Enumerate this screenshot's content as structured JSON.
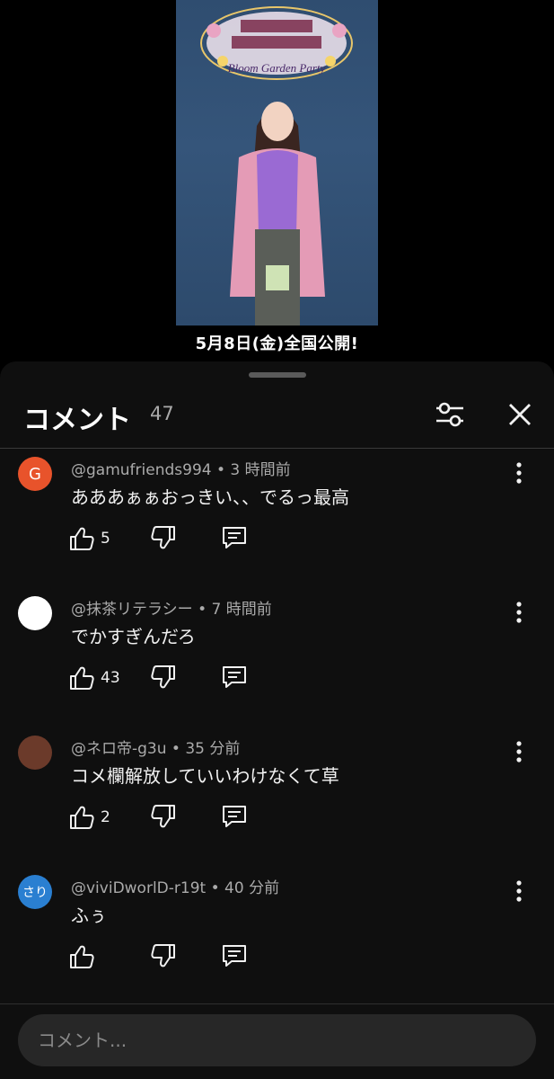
{
  "video": {
    "poster_logo_text": "Bloom Garden Party",
    "caption": "5月8日(金)全国公開!"
  },
  "header": {
    "title": "コメント",
    "count": "47",
    "filter_icon": "sliders-icon",
    "close_icon": "close-icon"
  },
  "comments": [
    {
      "author": "@gamufriends994",
      "time": "3 時間前",
      "text": "あああぁぁおっきい、、でるっ最高",
      "likes": "5",
      "avatar": {
        "letter": "G",
        "color": "#e8532b"
      }
    },
    {
      "author": "@抹茶リテラシー",
      "time": "7 時間前",
      "text": "でかすぎんだろ",
      "likes": "43",
      "avatar": {
        "letter": "",
        "color": "#ffffff"
      }
    },
    {
      "author": "@ネロ帝-g3u",
      "time": "35 分前",
      "text": "コメ欄解放していいわけなくて草",
      "likes": "2",
      "avatar": {
        "letter": "",
        "color": "#6b3a2a"
      }
    },
    {
      "author": "@viviDworlD-r19t",
      "time": "40 分前",
      "text": "ふぅ",
      "likes": "",
      "avatar": {
        "letter": "さり",
        "color": "#2a7fd1"
      }
    }
  ],
  "input": {
    "placeholder": "コメント..."
  }
}
